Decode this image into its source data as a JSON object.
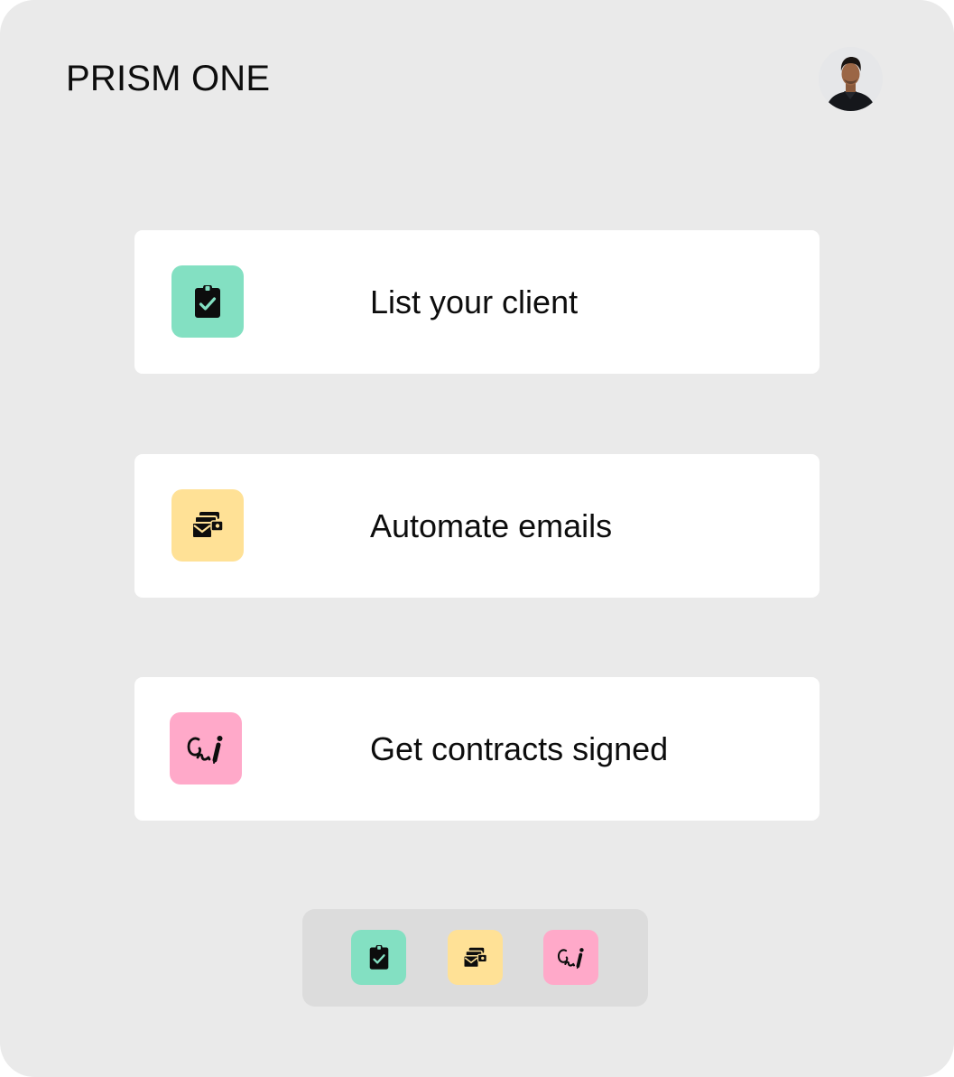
{
  "app": {
    "brand": "PRISM ONE"
  },
  "header": {
    "avatar_icon": "user-avatar-photo"
  },
  "cards": [
    {
      "label": "List your client",
      "icon": "clipboard-check-icon",
      "color": "#83e0c2"
    },
    {
      "label": "Automate emails",
      "icon": "email-stack-icon",
      "color": "#ffe196"
    },
    {
      "label": "Get contracts signed",
      "icon": "signature-pen-icon",
      "color": "#ffa9c9"
    }
  ],
  "dock": {
    "items": [
      {
        "icon": "clipboard-check-icon",
        "color": "#83e0c2"
      },
      {
        "icon": "email-stack-icon",
        "color": "#ffe196"
      },
      {
        "icon": "signature-pen-icon",
        "color": "#ffa9c9"
      }
    ]
  },
  "colors": {
    "background": "#eaeaea",
    "card": "#ffffff",
    "dock": "#dcdcdc",
    "text": "#0d0d0d"
  }
}
